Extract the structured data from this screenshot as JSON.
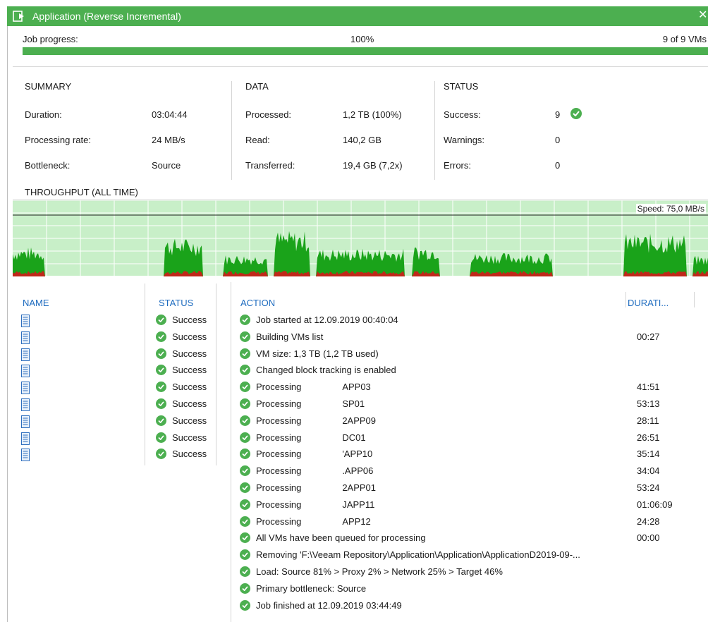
{
  "window": {
    "title": "Application (Reverse Incremental)",
    "close_glyph": "✕"
  },
  "progress": {
    "label": "Job progress:",
    "percent_text": "100%",
    "count_text": "9 of 9 VMs",
    "fraction": 1.0
  },
  "summary": {
    "heading": "SUMMARY",
    "rows": [
      {
        "label": "Duration:",
        "value": "03:04:44"
      },
      {
        "label": "Processing rate:",
        "value": "24 MB/s"
      },
      {
        "label": "Bottleneck:",
        "value": "Source"
      }
    ]
  },
  "data": {
    "heading": "DATA",
    "rows": [
      {
        "label": "Processed:",
        "value": "1,2 TB (100%)"
      },
      {
        "label": "Read:",
        "value": "140,2 GB"
      },
      {
        "label": "Transferred:",
        "value": "19,4 GB (7,2x)"
      }
    ]
  },
  "status": {
    "heading": "STATUS",
    "rows": [
      {
        "label": "Success:",
        "value": "9"
      },
      {
        "label": "Warnings:",
        "value": "0"
      },
      {
        "label": "Errors:",
        "value": "0"
      }
    ]
  },
  "throughput": {
    "label": "THROUGHPUT (ALL TIME)",
    "speed_text": "Speed: 75,0 MB/s"
  },
  "table": {
    "col_name": "NAME",
    "col_status": "STATUS",
    "col_action": "ACTION",
    "col_duration": "DURATI...",
    "vms": [
      {
        "status": "Success"
      },
      {
        "status": "Success"
      },
      {
        "status": "Success"
      },
      {
        "status": "Success"
      },
      {
        "status": "Success"
      },
      {
        "status": "Success"
      },
      {
        "status": "Success"
      },
      {
        "status": "Success"
      },
      {
        "status": "Success"
      }
    ],
    "actions": [
      {
        "text": "Job started at 12.09.2019 00:40:04",
        "suffix": "",
        "duration": ""
      },
      {
        "text": "Building VMs list",
        "suffix": "",
        "duration": "00:27"
      },
      {
        "text": "VM size: 1,3 TB (1,2 TB used)",
        "suffix": "",
        "duration": ""
      },
      {
        "text": "Changed block tracking is enabled",
        "suffix": "",
        "duration": ""
      },
      {
        "text": "Processing",
        "suffix": "APP03",
        "duration": "41:51"
      },
      {
        "text": "Processing",
        "suffix": "SP01",
        "duration": "53:13"
      },
      {
        "text": "Processing",
        "suffix": "2APP09",
        "duration": "28:11"
      },
      {
        "text": "Processing",
        "suffix": "DC01",
        "duration": "26:51"
      },
      {
        "text": "Processing",
        "suffix": "'APP10",
        "duration": "35:14"
      },
      {
        "text": "Processing",
        "suffix": ".APP06",
        "duration": "34:04"
      },
      {
        "text": "Processing",
        "suffix": "2APP01",
        "duration": "53:24"
      },
      {
        "text": "Processing",
        "suffix": "JAPP11",
        "duration": "01:06:09"
      },
      {
        "text": "Processing",
        "suffix": "APP12",
        "duration": "24:28"
      },
      {
        "text": "All VMs have been queued for processing",
        "suffix": "",
        "duration": "00:00"
      },
      {
        "text": "Removing  'F:\\Veeam  Repository\\Application\\Application\\ApplicationD2019-09-...",
        "suffix": "",
        "duration": ""
      },
      {
        "text": "Load: Source 81% > Proxy 2% > Network 25% > Target 46%",
        "suffix": "",
        "duration": ""
      },
      {
        "text": "Primary bottleneck: Source",
        "suffix": "",
        "duration": ""
      },
      {
        "text": "Job finished at 12.09.2019 03:44:49",
        "suffix": "",
        "duration": ""
      }
    ]
  },
  "colors": {
    "accent": "#4caf50",
    "link_blue": "#1d6bbf",
    "chart_bg": "#c8efc8",
    "chart_green": "#1aa31a",
    "chart_red": "#c0281a"
  }
}
